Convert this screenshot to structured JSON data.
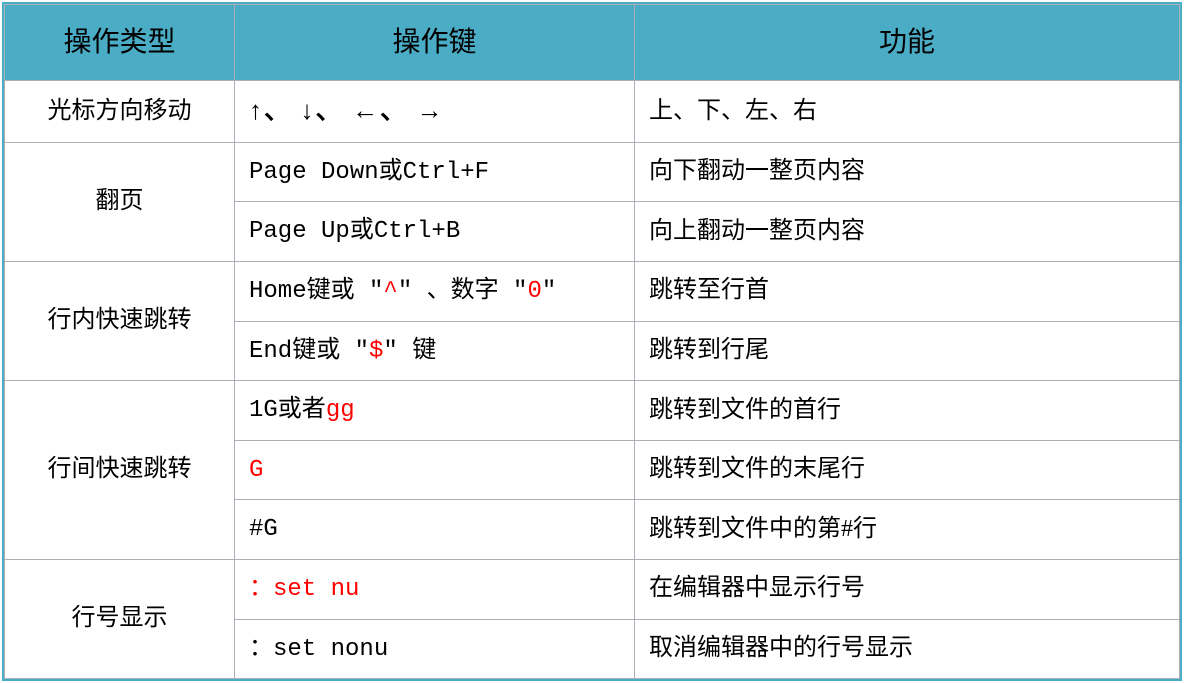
{
  "headers": {
    "col1": "操作类型",
    "col2": "操作键",
    "col3": "功能"
  },
  "rows": [
    {
      "type": "光标方向移动",
      "key_parts": [
        {
          "text": "↑、 ↓、 ←、 →",
          "cls": "arrows"
        }
      ],
      "func": "上、下、左、右",
      "rowspan": 1
    },
    {
      "type": "翻页",
      "key_parts": [
        {
          "text": "Page Down或Ctrl+F",
          "cls": "mono"
        }
      ],
      "func": "向下翻动一整页内容",
      "rowspan": 2
    },
    {
      "type": null,
      "key_parts": [
        {
          "text": "Page Up或Ctrl+B",
          "cls": "mono"
        }
      ],
      "func": "向上翻动一整页内容"
    },
    {
      "type": "行内快速跳转",
      "key_parts": [
        {
          "text": "Home键或 \"",
          "cls": "mono"
        },
        {
          "text": "^",
          "cls": "mono red"
        },
        {
          "text": "\" 、数字 \"",
          "cls": "mono"
        },
        {
          "text": "0",
          "cls": "mono red"
        },
        {
          "text": "\"",
          "cls": "mono"
        }
      ],
      "func": "跳转至行首",
      "rowspan": 2
    },
    {
      "type": null,
      "key_parts": [
        {
          "text": "End键或 \"",
          "cls": "mono"
        },
        {
          "text": "$",
          "cls": "mono red"
        },
        {
          "text": "\" 键",
          "cls": "mono"
        }
      ],
      "func": "跳转到行尾"
    },
    {
      "type": "行间快速跳转",
      "key_parts": [
        {
          "text": "1G或者",
          "cls": "mono"
        },
        {
          "text": "gg",
          "cls": "mono red"
        }
      ],
      "func": "跳转到文件的首行",
      "rowspan": 3
    },
    {
      "type": null,
      "key_parts": [
        {
          "text": "G",
          "cls": "mono red"
        }
      ],
      "func": "跳转到文件的末尾行"
    },
    {
      "type": null,
      "key_parts": [
        {
          "text": "#G",
          "cls": "mono"
        }
      ],
      "func": "跳转到文件中的第#行"
    },
    {
      "type": "行号显示",
      "key_parts": [
        {
          "text": "：set nu",
          "cls": "mono red"
        }
      ],
      "func": "在编辑器中显示行号",
      "rowspan": 2
    },
    {
      "type": null,
      "key_parts": [
        {
          "text": "：set nonu",
          "cls": "mono"
        }
      ],
      "func": "取消编辑器中的行号显示"
    }
  ]
}
